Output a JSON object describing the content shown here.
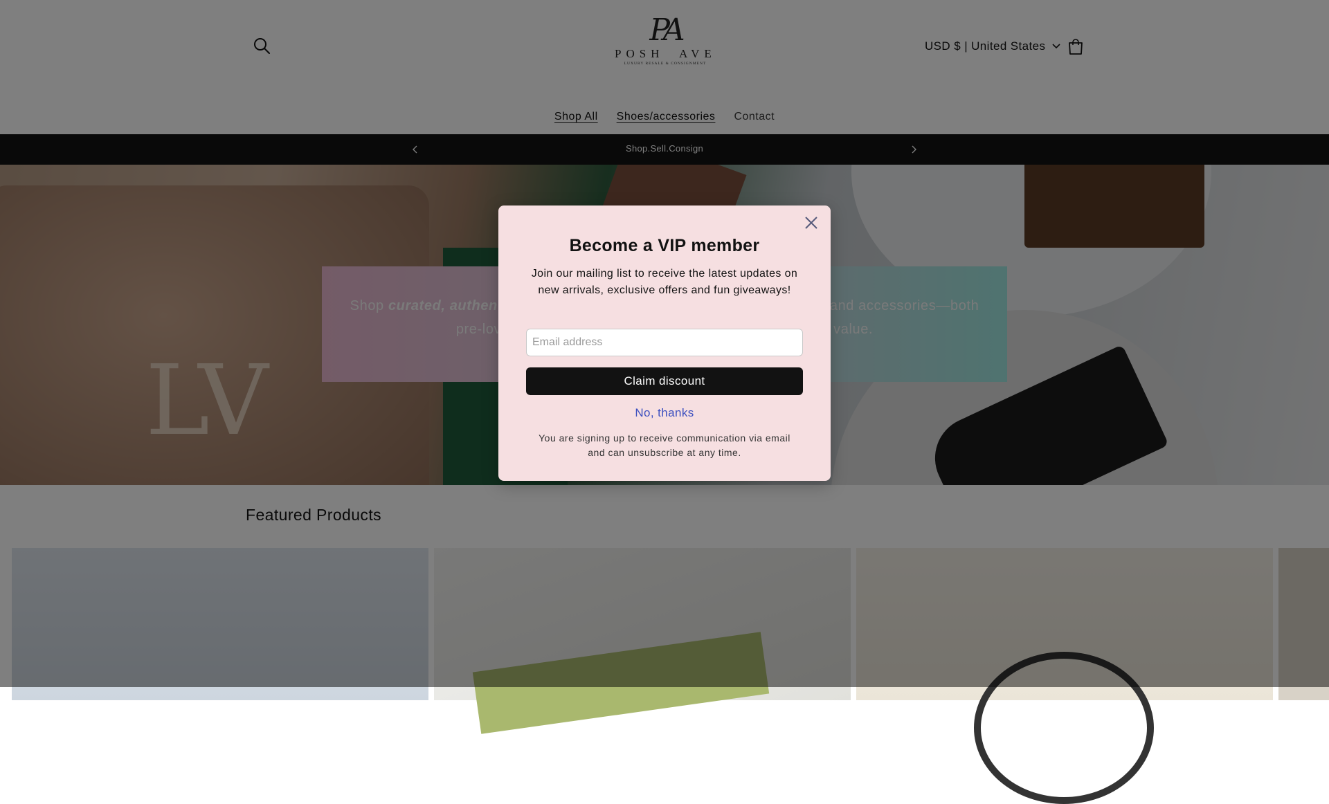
{
  "header": {
    "logo": {
      "monogram": "PA",
      "name": "POSH  AVE",
      "tagline": "Luxury Resale & Consignment"
    },
    "currency_label": "USD $ | United States"
  },
  "nav": {
    "items": [
      {
        "label": "Shop All"
      },
      {
        "label": "Shoes/accessories"
      },
      {
        "label": "Contact"
      }
    ]
  },
  "announcement": {
    "text": "Shop.Sell.Consign"
  },
  "hero": {
    "text_start": "Shop ",
    "text_emphasis": "curated, authen",
    "text_end_line1": "and accessories—both",
    "text_line2_start": "pre-lov",
    "text_line2_end": "value."
  },
  "featured": {
    "title": "Featured Products"
  },
  "modal": {
    "title": "Become a VIP member",
    "description": "Join our mailing list to receive the latest updates on new arrivals, exclusive offers and fun giveaways!",
    "email_placeholder": "Email address",
    "claim_label": "Claim discount",
    "no_thanks_label": "No, thanks",
    "legal": "You are signing up to receive communication via email and can unsubscribe at any time."
  },
  "colors": {
    "modal_bg": "#f6dfe1",
    "button_bg": "#121212",
    "link": "#3c4fbf",
    "announcement_bg": "#121212"
  }
}
